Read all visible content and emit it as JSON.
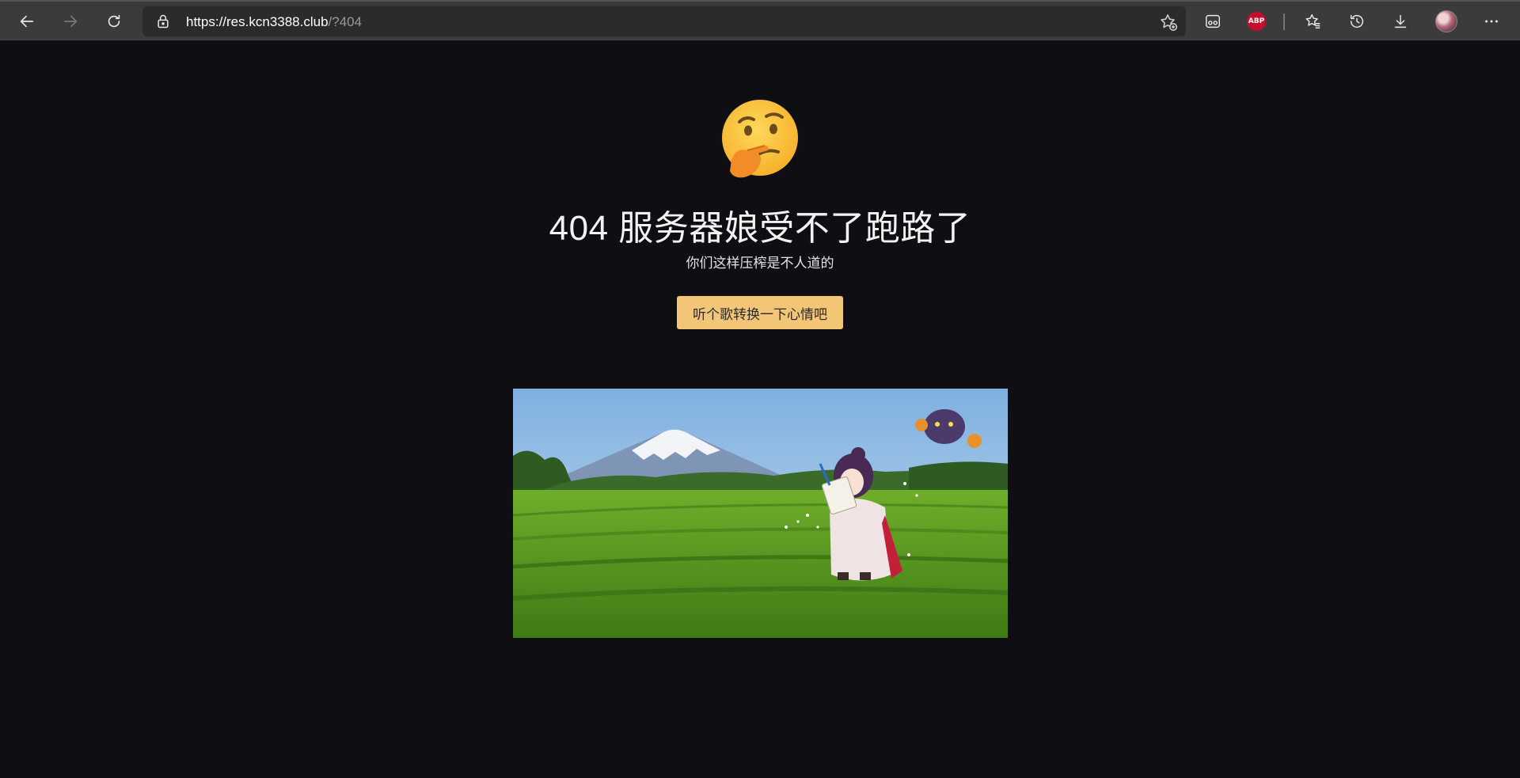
{
  "browser": {
    "url_host": "https://res.kcn3388.club",
    "url_rest": "/?404",
    "abp_label": "ABP",
    "icons": [
      "back-icon",
      "forward-icon",
      "refresh-icon",
      "lock-icon",
      "add-favorite-icon",
      "immersive-reader-icon",
      "abp-icon",
      "favorites-icon",
      "history-icon",
      "download-icon",
      "profile-avatar",
      "more-icon"
    ]
  },
  "page": {
    "emoji": "thinking-face",
    "title": "404 服务器娘受不了跑路了",
    "subtitle": "你们这样压榨是不人道的",
    "button_label": "听个歌转换一下心情吧",
    "button_color": "#f3c677",
    "background": "#0f0f13"
  }
}
